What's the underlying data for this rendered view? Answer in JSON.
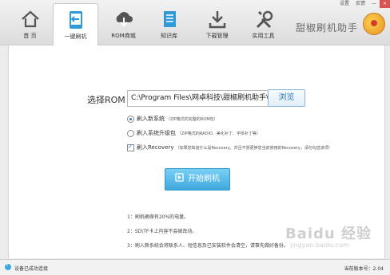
{
  "window": {
    "settings": "设置",
    "feedback": "反馈",
    "minimize": "—",
    "close": "×"
  },
  "tabs": [
    {
      "label": "首 页",
      "icon": "home-icon"
    },
    {
      "label": "一键刷机",
      "icon": "flash-phone-icon"
    },
    {
      "label": "ROM商城",
      "icon": "download-cloud-icon"
    },
    {
      "label": "知识库",
      "icon": "document-icon"
    },
    {
      "label": "下载管理",
      "icon": "download-icon"
    },
    {
      "label": "实用工具",
      "icon": "tools-icon"
    }
  ],
  "brand": {
    "name": "甜椒刷机助手"
  },
  "rom": {
    "label": "选择ROM",
    "path": "C:\\Program Files\\网卓科技\\甜椒刷机助手\\",
    "browse": "浏览"
  },
  "options": [
    {
      "label": "刷入新系统",
      "hint": "（ZIP格式的完整的ROM包）",
      "type": "radio",
      "selected": true
    },
    {
      "label": "刷入系统升级包",
      "hint": "（ZIP格式的RADIO、美化补丁、字体补丁等）",
      "type": "radio",
      "selected": false
    },
    {
      "label": "刷入Recovery",
      "hint": "（如果您知道什么是Recovery，并且不想更换您当前使用的Recovery，请勿勾选该项）",
      "type": "checkbox",
      "selected": true
    }
  ],
  "start_button": "开始刷机",
  "notes": [
    "1：刷机确保有20%的电量。",
    "2：SD\\TF卡上内容不会被改动。",
    "3：刷入新系统会将联系人、短信息及已安装软件会清空，请事先做好备份。"
  ],
  "watermark": {
    "line1": "Baidu 经验",
    "line2": "jingyan.baidu.com"
  },
  "status": {
    "text": "设备已成功连接",
    "version": "当前版本号：2.04"
  },
  "colors": {
    "accent": "#3fa8e0",
    "brand_orange": "#e5912a"
  }
}
